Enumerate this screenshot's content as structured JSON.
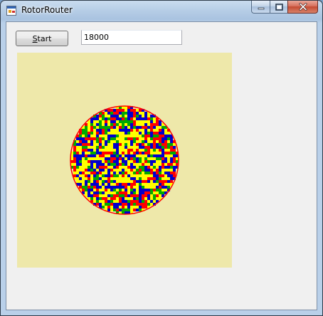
{
  "window": {
    "title": "RotorRouter",
    "app_icon": "windows-form-icon",
    "minimize_icon": "minimize-icon",
    "maximize_icon": "maximize-icon",
    "close_icon": "close-icon"
  },
  "controls": {
    "start_label_underlined": "S",
    "start_label_rest": "tart",
    "input_value": "18000"
  },
  "canvas": {
    "background": "#eee8aa",
    "rim_color": "#ff0000",
    "rotor_colors": [
      "#0000cc",
      "#ffff00",
      "#ff0000",
      "#00aa00"
    ]
  }
}
